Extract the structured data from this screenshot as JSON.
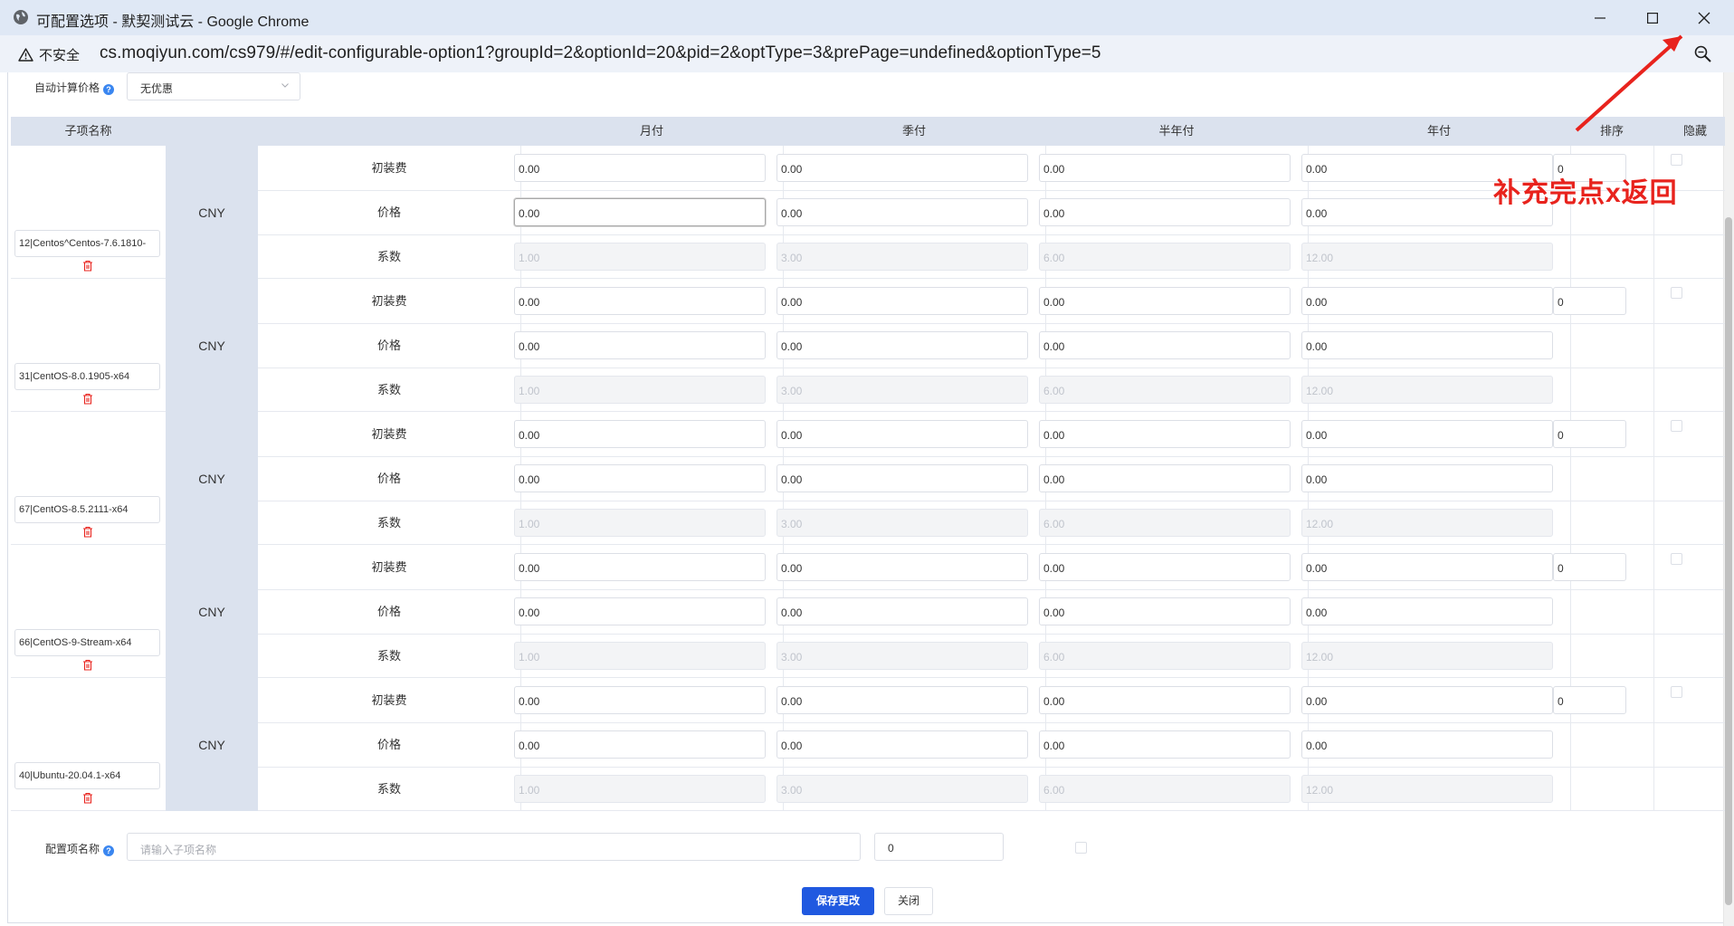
{
  "browser": {
    "window_title": "可配置选项 - 默契测试云 - Google Chrome",
    "security_label": "不安全",
    "url": "cs.moqiyun.com/cs979/#/edit-configurable-option1?groupId=2&optionId=20&pid=2&optType=3&prePage=undefined&optionType=5"
  },
  "form": {
    "auto_price_label": "自动计算价格",
    "help_mark": "?",
    "auto_price_value": "无优惠"
  },
  "table": {
    "headers": {
      "name": "子项名称",
      "monthly": "月付",
      "quarterly": "季付",
      "semiannual": "半年付",
      "annual": "年付",
      "sort": "排序",
      "hide": "隐藏"
    },
    "row_labels": {
      "setup": "初装费",
      "price": "价格",
      "factor": "系数"
    },
    "currency": "CNY",
    "items": [
      {
        "name": "12|Centos^Centos-7.6.1810-",
        "setup": [
          "0.00",
          "0.00",
          "0.00",
          "0.00"
        ],
        "price": [
          "0.00",
          "0.00",
          "0.00",
          "0.00"
        ],
        "factor": [
          "1.00",
          "3.00",
          "6.00",
          "12.00"
        ],
        "sort": "0"
      },
      {
        "name": "31|CentOS-8.0.1905-x64",
        "setup": [
          "0.00",
          "0.00",
          "0.00",
          "0.00"
        ],
        "price": [
          "0.00",
          "0.00",
          "0.00",
          "0.00"
        ],
        "factor": [
          "1.00",
          "3.00",
          "6.00",
          "12.00"
        ],
        "sort": "0"
      },
      {
        "name": "67|CentOS-8.5.2111-x64",
        "setup": [
          "0.00",
          "0.00",
          "0.00",
          "0.00"
        ],
        "price": [
          "0.00",
          "0.00",
          "0.00",
          "0.00"
        ],
        "factor": [
          "1.00",
          "3.00",
          "6.00",
          "12.00"
        ],
        "sort": "0"
      },
      {
        "name": "66|CentOS-9-Stream-x64",
        "setup": [
          "0.00",
          "0.00",
          "0.00",
          "0.00"
        ],
        "price": [
          "0.00",
          "0.00",
          "0.00",
          "0.00"
        ],
        "factor": [
          "1.00",
          "3.00",
          "6.00",
          "12.00"
        ],
        "sort": "0"
      },
      {
        "name": "40|Ubuntu-20.04.1-x64",
        "setup": [
          "0.00",
          "0.00",
          "0.00",
          "0.00"
        ],
        "price": [
          "0.00",
          "0.00",
          "0.00",
          "0.00"
        ],
        "factor": [
          "1.00",
          "3.00",
          "6.00",
          "12.00"
        ],
        "sort": "0"
      }
    ]
  },
  "new_item": {
    "label": "配置项名称",
    "placeholder": "请输入子项名称",
    "sort_value": "0"
  },
  "actions": {
    "save": "保存更改",
    "close": "关闭"
  },
  "annotation": {
    "text": "补充完点x返回",
    "color": "#e8231d"
  },
  "icons": [
    "globe-icon",
    "minimize-icon",
    "maximize-icon",
    "close-icon",
    "warning-icon",
    "zoom-icon",
    "chevron-down-icon",
    "trash-icon",
    "help-icon"
  ],
  "colors": {
    "accent": "#2059e0",
    "header_bg": "#dbe2ee",
    "danger": "#e8231d"
  }
}
